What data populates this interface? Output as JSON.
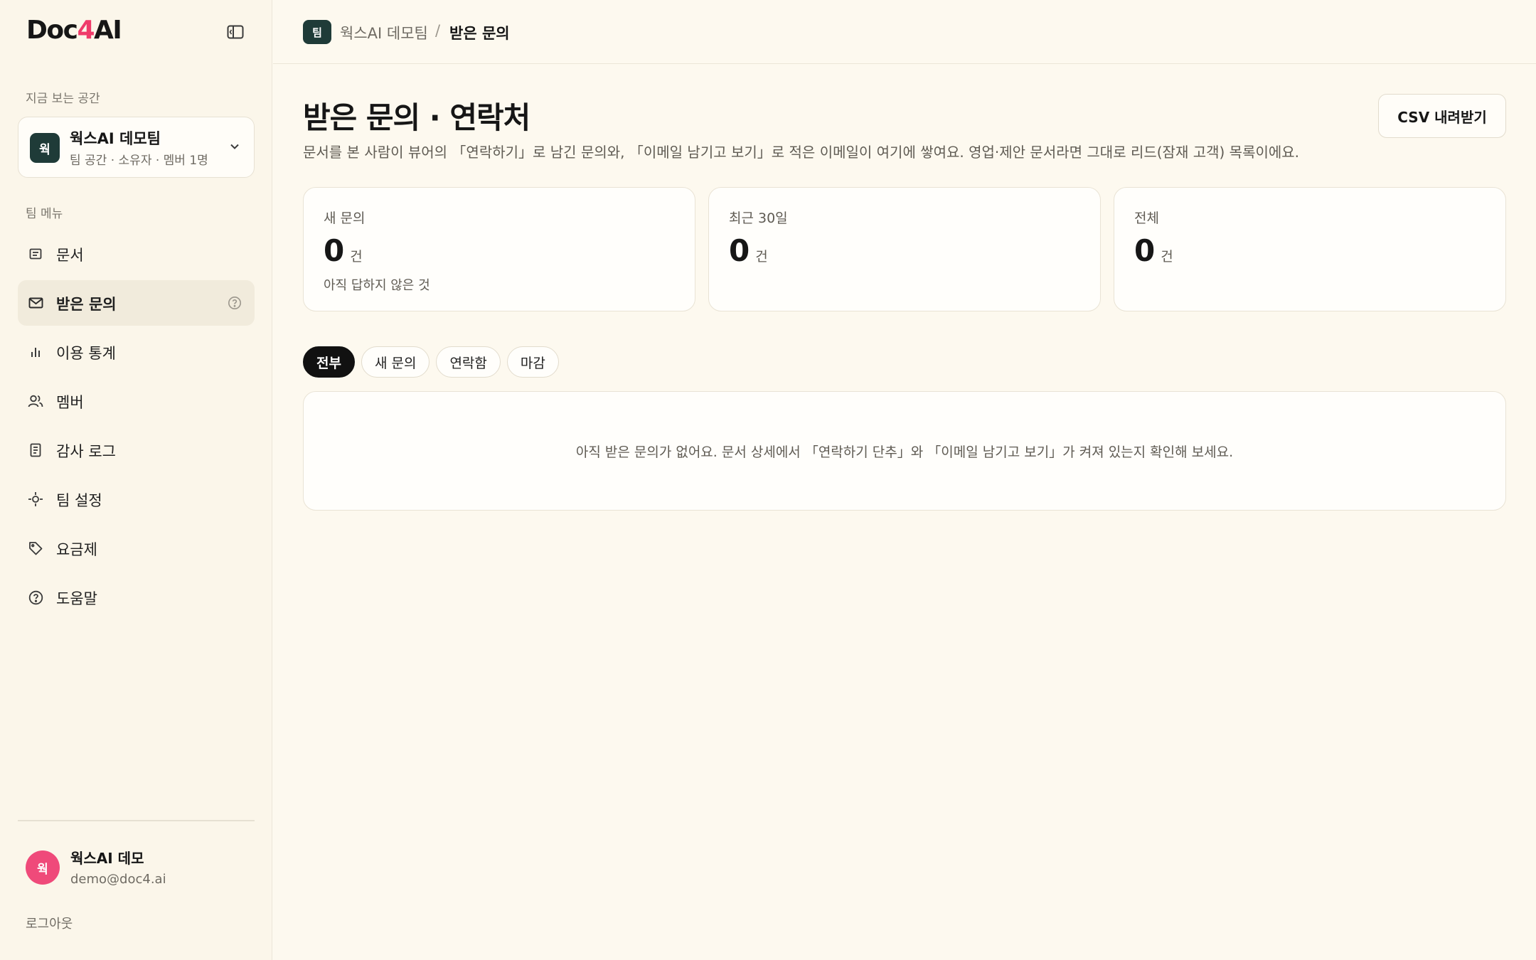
{
  "brand": {
    "logo_prefix": "Doc",
    "logo_accent": "4",
    "logo_suffix": "AI",
    "accent_color": "#ef3b6a"
  },
  "sidebar": {
    "workspace_section_label": "지금 보는 공간",
    "workspace": {
      "avatar": "웍",
      "name": "웍스AI 데모팀",
      "sub": "팀 공간 · 소유자 · 멤버 1명"
    },
    "menu_section_label": "팀 메뉴",
    "items": [
      {
        "label": "문서",
        "icon": "document-icon"
      },
      {
        "label": "받은 문의",
        "icon": "mail-icon",
        "active": true
      },
      {
        "label": "이용 통계",
        "icon": "bar-chart-icon"
      },
      {
        "label": "멤버",
        "icon": "users-icon"
      },
      {
        "label": "감사 로그",
        "icon": "log-icon"
      },
      {
        "label": "팀 설정",
        "icon": "settings-icon"
      },
      {
        "label": "요금제",
        "icon": "tag-icon"
      },
      {
        "label": "도움말",
        "icon": "help-icon"
      }
    ],
    "user": {
      "avatar": "웍",
      "name": "웍스AI 데모",
      "email": "demo@doc4.ai"
    },
    "logout_label": "로그아웃"
  },
  "topbar": {
    "badge": "팀",
    "team": "웍스AI 데모팀",
    "separator": "/",
    "current": "받은 문의"
  },
  "main": {
    "title": "받은 문의 · 연락처",
    "description": "문서를 본 사람이 뷰어의 「연락하기」로 남긴 문의와, 「이메일 남기고 보기」로 적은 이메일이 여기에 쌓여요. 영업·제안 문서라면 그대로 리드(잠재 고객) 목록이에요.",
    "csv_button": "CSV 내려받기",
    "stats": [
      {
        "label": "새 문의",
        "value": "0",
        "unit": "건",
        "sub": "아직 답하지 않은 것"
      },
      {
        "label": "최근 30일",
        "value": "0",
        "unit": "건",
        "sub": ""
      },
      {
        "label": "전체",
        "value": "0",
        "unit": "건",
        "sub": ""
      }
    ],
    "filters": [
      "전부",
      "새 문의",
      "연락함",
      "마감"
    ],
    "active_filter": "전부",
    "empty_message": "아직 받은 문의가 없어요. 문서 상세에서 「연락하기 단추」와 「이메일 남기고 보기」가 켜져 있는지 확인해 보세요."
  }
}
